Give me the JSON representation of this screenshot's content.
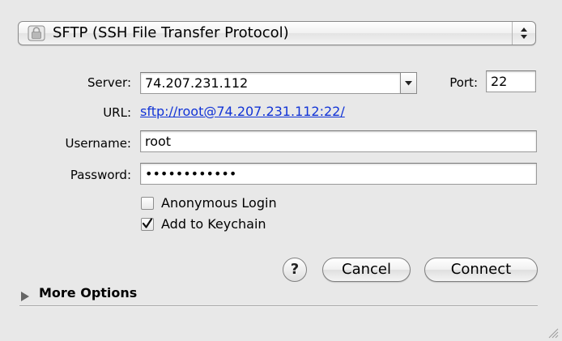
{
  "protocol": {
    "label": "SFTP (SSH File Transfer Protocol)",
    "icon": "lock-icon"
  },
  "form": {
    "server_label": "Server:",
    "server_value": "74.207.231.112",
    "port_label": "Port:",
    "port_value": "22",
    "url_label": "URL:",
    "url_value": "sftp://root@74.207.231.112:22/",
    "username_label": "Username:",
    "username_value": "root",
    "password_label": "Password:",
    "password_value": "••••••••••••"
  },
  "options": {
    "anonymous_label": "Anonymous Login",
    "anonymous_checked": false,
    "keychain_label": "Add to Keychain",
    "keychain_checked": true
  },
  "buttons": {
    "help_label": "?",
    "cancel_label": "Cancel",
    "connect_label": "Connect"
  },
  "more_options_label": "More Options",
  "colors": {
    "link": "#1234d6",
    "background": "#e8e8e8"
  }
}
